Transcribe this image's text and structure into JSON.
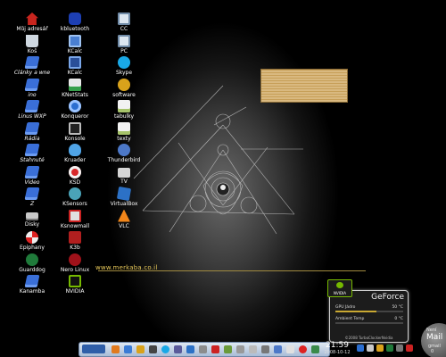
{
  "desktop": {
    "url_text": "www.merkaba.co.il",
    "columns": [
      [
        {
          "label": "Můj adresář",
          "icon": "home-icon",
          "glyph": "home",
          "italic": false
        },
        {
          "label": "Koš",
          "icon": "trash-icon",
          "glyph": "trash",
          "italic": false
        },
        {
          "label": "Články a wne",
          "icon": "folder-icon",
          "glyph": "folder",
          "italic": true
        },
        {
          "label": "ino",
          "icon": "folder-icon",
          "glyph": "folder",
          "italic": true
        },
        {
          "label": "Linus WXP",
          "icon": "folder-icon",
          "glyph": "folder",
          "italic": true
        },
        {
          "label": "Rádia",
          "icon": "folder-icon",
          "glyph": "folder",
          "italic": true
        },
        {
          "label": "Stahnuté",
          "icon": "folder-icon",
          "glyph": "folder",
          "italic": true
        },
        {
          "label": "Video",
          "icon": "folder-icon",
          "glyph": "folder",
          "italic": true
        },
        {
          "label": "Z",
          "icon": "folder-icon",
          "glyph": "folder",
          "italic": true
        },
        {
          "label": "Disky",
          "icon": "drive-icon",
          "glyph": "drive",
          "italic": false
        },
        {
          "label": "Epiphany",
          "icon": "lifebuoy-icon",
          "glyph": "lifebuoy",
          "italic": false
        },
        {
          "label": "Guarddog",
          "icon": "dog-icon",
          "glyph": "dog",
          "italic": false
        },
        {
          "label": "Kanamba",
          "icon": "folder-icon",
          "glyph": "folder",
          "italic": false
        }
      ],
      [
        {
          "label": "kbluetooth",
          "icon": "bluetooth-icon",
          "glyph": "bt",
          "italic": false
        },
        {
          "label": "KCalc",
          "icon": "calculator-icon",
          "glyph": "calc",
          "italic": false
        },
        {
          "label": "KCalc",
          "icon": "calculator-icon",
          "glyph": "calc2",
          "italic": false
        },
        {
          "label": "KNetStats",
          "icon": "network-chart-icon",
          "glyph": "chart",
          "italic": false
        },
        {
          "label": "Konqueror",
          "icon": "browser-icon",
          "glyph": "konq",
          "italic": false
        },
        {
          "label": "Konsole",
          "icon": "terminal-icon",
          "glyph": "monitor",
          "italic": false
        },
        {
          "label": "Kruader",
          "icon": "cloud-icon",
          "glyph": "cloud",
          "italic": false
        },
        {
          "label": "KSD",
          "icon": "ksd-icon",
          "glyph": "ksd",
          "italic": false
        },
        {
          "label": "KSensors",
          "icon": "sensors-icon",
          "glyph": "ksensors",
          "italic": false
        },
        {
          "label": "Ksnowmall",
          "icon": "snapshot-icon",
          "glyph": "ksnap",
          "italic": false
        },
        {
          "label": "K3b",
          "icon": "k3b-icon",
          "glyph": "k3b",
          "italic": false
        },
        {
          "label": "Nero Linux",
          "icon": "nero-icon",
          "glyph": "nero",
          "italic": false
        },
        {
          "label": "NVIDIA",
          "icon": "nvidia-icon",
          "glyph": "nvidia",
          "italic": false
        }
      ],
      [
        {
          "label": "CC",
          "icon": "computer-icon",
          "glyph": "pc",
          "italic": false
        },
        {
          "label": "PC",
          "icon": "computer-icon",
          "glyph": "pc",
          "italic": false
        },
        {
          "label": "Skype",
          "icon": "skype-icon",
          "glyph": "skype",
          "italic": false
        },
        {
          "label": "software",
          "icon": "gear-icon",
          "glyph": "gear",
          "italic": false
        },
        {
          "label": "tabulky",
          "icon": "spreadsheet-icon",
          "glyph": "doc",
          "italic": false
        },
        {
          "label": "texty",
          "icon": "document-icon",
          "glyph": "doc",
          "italic": false
        },
        {
          "label": "Thunderbird",
          "icon": "thunderbird-icon",
          "glyph": "tb",
          "italic": false
        },
        {
          "label": "TV",
          "icon": "tv-icon",
          "glyph": "tv",
          "italic": false
        },
        {
          "label": "VirtualBox",
          "icon": "virtualbox-icon",
          "glyph": "vbox",
          "italic": false
        },
        {
          "label": "VLC",
          "icon": "vlc-cone-icon",
          "glyph": "vlc",
          "italic": false
        }
      ]
    ]
  },
  "geforce": {
    "title": "GeForce",
    "logo_text": "NVIDIA",
    "rows": [
      {
        "label": "GPU Jádro",
        "value": "50 °C",
        "fill": 0.6
      },
      {
        "label": "Ambient Temp",
        "value": "0 °C",
        "fill": 0.0
      }
    ],
    "footer": "©2008 TurboClockerNvidia"
  },
  "mail": {
    "line1": "Není",
    "line2": "Mail",
    "line3": "gmail",
    "line4": "0"
  },
  "taskbar": {
    "clock_time": "21:59",
    "clock_date": "2008-10-12"
  },
  "colors": {
    "accent_nvidia": "#76b900",
    "url": "#e8c95a",
    "taskbar": "#a8bcd6"
  }
}
